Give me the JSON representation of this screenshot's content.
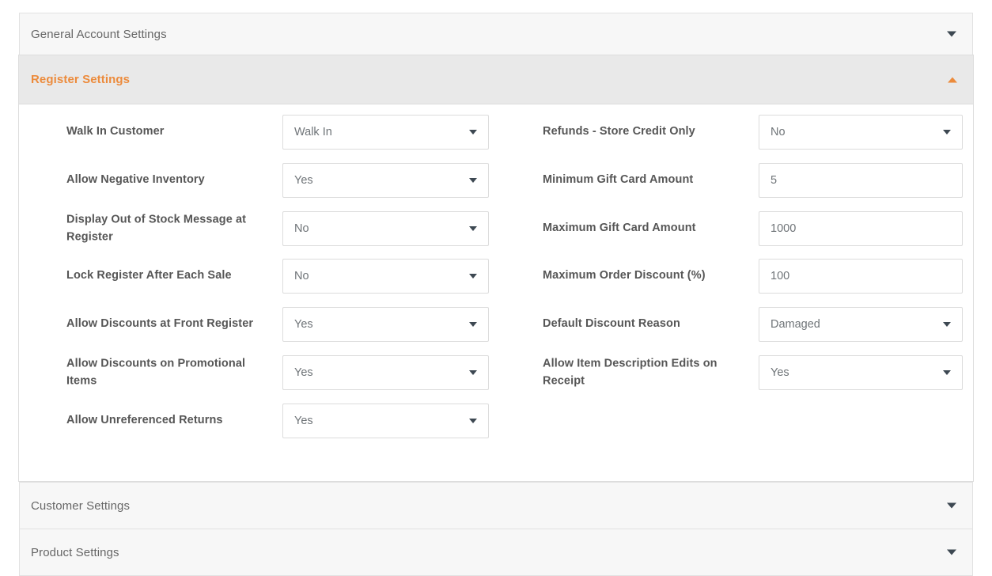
{
  "accordion": {
    "panels": [
      {
        "id": "general-account-settings",
        "title": "General Account Settings",
        "state": "collapsed",
        "caret_icon": "chevron-down-icon"
      },
      {
        "id": "register-settings",
        "title": "Register Settings",
        "state": "expanded",
        "caret_icon": "chevron-up-icon"
      },
      {
        "id": "customer-settings",
        "title": "Customer Settings",
        "state": "collapsed",
        "caret_icon": "chevron-down-icon"
      },
      {
        "id": "product-settings",
        "title": "Product Settings",
        "state": "collapsed",
        "caret_icon": "chevron-down-icon"
      }
    ]
  },
  "register_settings": {
    "left_column": [
      {
        "label": "Walk In Customer",
        "type": "select",
        "value": "Walk In"
      },
      {
        "label": "Allow Negative Inventory",
        "type": "select",
        "value": "Yes"
      },
      {
        "label": "Display Out of Stock Message at Register",
        "type": "select",
        "value": "No"
      },
      {
        "label": "Lock Register After Each Sale",
        "type": "select",
        "value": "No"
      },
      {
        "label": "Allow Discounts at Front Register",
        "type": "select",
        "value": "Yes"
      },
      {
        "label": "Allow Discounts on Promotional Items",
        "type": "select",
        "value": "Yes"
      },
      {
        "label": "Allow Unreferenced Returns",
        "type": "select",
        "value": "Yes"
      }
    ],
    "right_column": [
      {
        "label": "Refunds - Store Credit Only",
        "type": "select",
        "value": "No"
      },
      {
        "label": "Minimum Gift Card Amount",
        "type": "text",
        "value": "5"
      },
      {
        "label": "Maximum Gift Card Amount",
        "type": "text",
        "value": "1000"
      },
      {
        "label": "Maximum Order Discount (%)",
        "type": "text",
        "value": "100"
      },
      {
        "label": "Default Discount Reason",
        "type": "select",
        "value": "Damaged"
      },
      {
        "label": "Allow Item Description Edits on Receipt",
        "type": "select",
        "value": "Yes"
      }
    ]
  },
  "colors": {
    "accent_orange": "#ec8b3c",
    "panel_header_active": "#e9e9e9",
    "panel_header_collapsed": "#f7f7f7",
    "label_text": "#565656",
    "value_text": "#6f7478",
    "caret_dark": "#3d4852",
    "border": "#dcdcdc"
  }
}
